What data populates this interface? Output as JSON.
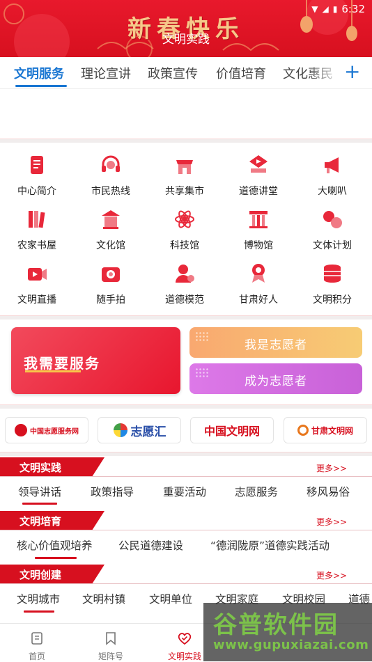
{
  "status_bar": {
    "time": "6:32"
  },
  "header": {
    "banner_text": "新春快乐",
    "title": "文明实践"
  },
  "tabs": {
    "items": [
      "文明服务",
      "理论宣讲",
      "政策宣传",
      "价值培育",
      "文化惠民"
    ],
    "active_index": 0,
    "add_symbol": "+"
  },
  "grid": {
    "items": [
      {
        "label": "中心简介",
        "icon": "document-icon"
      },
      {
        "label": "市民热线",
        "icon": "headset-icon"
      },
      {
        "label": "共享集市",
        "icon": "market-stall-icon"
      },
      {
        "label": "道德讲堂",
        "icon": "play-book-icon"
      },
      {
        "label": "大喇叭",
        "icon": "megaphone-icon"
      },
      {
        "label": "农家书屋",
        "icon": "bookshelf-icon"
      },
      {
        "label": "文化馆",
        "icon": "cultural-hall-icon"
      },
      {
        "label": "科技馆",
        "icon": "atom-icon"
      },
      {
        "label": "博物馆",
        "icon": "museum-icon"
      },
      {
        "label": "文体计划",
        "icon": "sports-icon"
      },
      {
        "label": "文明直播",
        "icon": "video-camera-icon"
      },
      {
        "label": "随手拍",
        "icon": "camera-icon"
      },
      {
        "label": "道德模范",
        "icon": "person-plus-icon"
      },
      {
        "label": "甘肃好人",
        "icon": "medal-person-icon"
      },
      {
        "label": "文明积分",
        "icon": "coins-icon"
      }
    ]
  },
  "services": {
    "need_service": "我需要服务",
    "i_am_volunteer": "我是志愿者",
    "become_volunteer": "成为志愿者"
  },
  "partner_logos": [
    {
      "name": "中国志愿服务网",
      "icon": "china-volunteer-logo-icon"
    },
    {
      "name": "志愿汇",
      "icon": "pinwheel-logo-icon"
    },
    {
      "name": "中国文明网",
      "icon": "wenming-logo-icon"
    },
    {
      "name": "甘肃文明网",
      "icon": "gansu-wenming-logo-icon"
    }
  ],
  "sections": [
    {
      "title": "文明实践",
      "more": "更多>>",
      "items": [
        "领导讲话",
        "政策指导",
        "重要活动",
        "志愿服务",
        "移风易俗"
      ]
    },
    {
      "title": "文明培育",
      "more": "更多>>",
      "items": [
        "核心价值观培养",
        "公民道德建设",
        "“德润陇原”道德实践活动"
      ]
    },
    {
      "title": "文明创建",
      "more": "更多>>",
      "items": [
        "文明城市",
        "文明村镇",
        "文明单位",
        "文明家庭",
        "文明校园",
        "道德"
      ]
    }
  ],
  "bottom_nav": [
    {
      "label": "首页",
      "icon": "home-doc-icon"
    },
    {
      "label": "矩阵号",
      "icon": "bookmark-icon"
    },
    {
      "label": "文明实践",
      "icon": "heart-check-icon"
    },
    {
      "label": "",
      "icon": ""
    },
    {
      "label": "",
      "icon": ""
    }
  ],
  "watermark": {
    "title": "谷普软件园",
    "url": "www.gupuxiazai.com"
  },
  "colors": {
    "brand_red": "#d7101f",
    "tab_blue": "#1976d2",
    "banner_gold": "#f6c98a"
  }
}
